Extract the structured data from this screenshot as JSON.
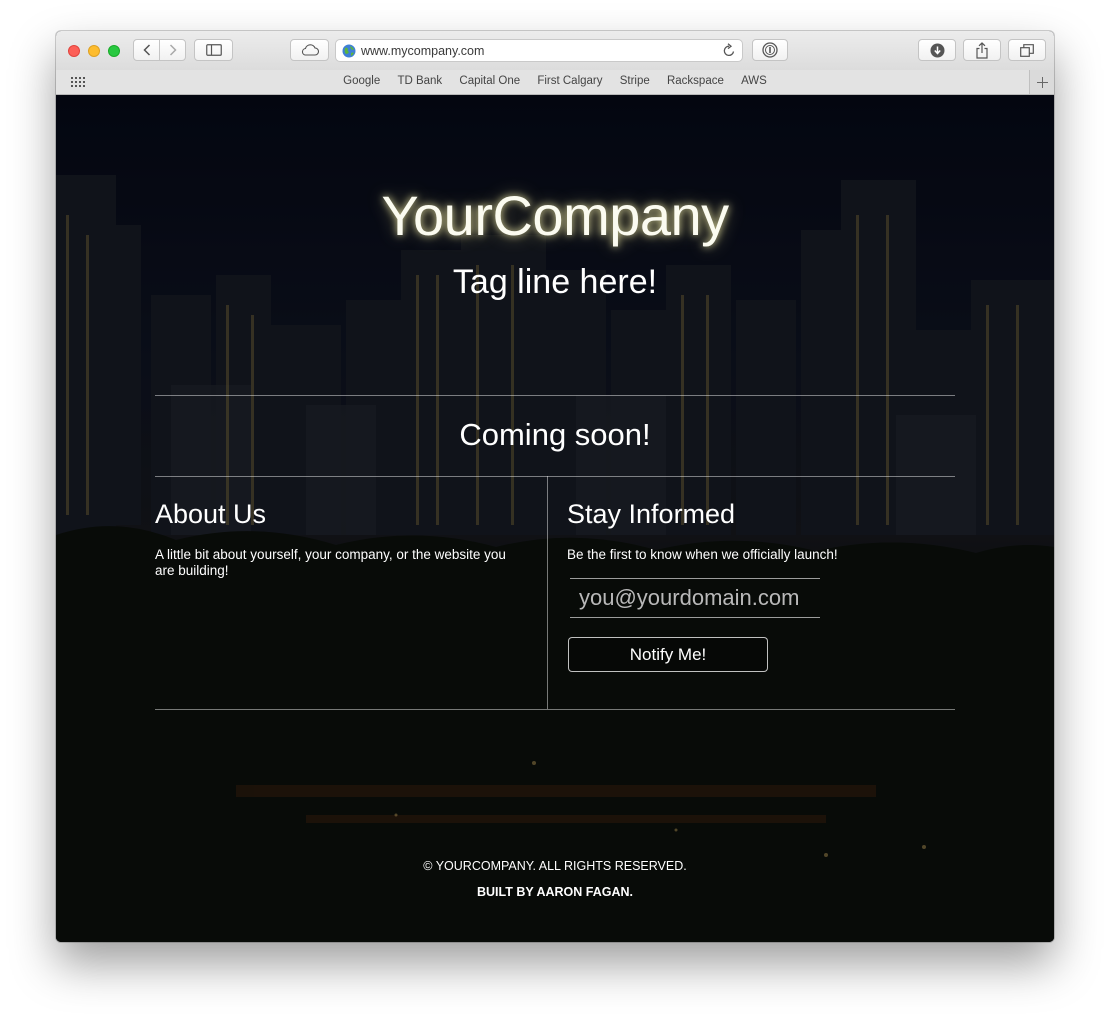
{
  "browser": {
    "url": "www.mycompany.com",
    "bookmarks": [
      "Google",
      "TD Bank",
      "Capital One",
      "First Calgary",
      "Stripe",
      "Rackspace",
      "AWS"
    ],
    "icons": {
      "back": "chevron-left-icon",
      "forward": "chevron-right-icon",
      "sidebar": "sidebar-icon",
      "cloud": "icloud-tabs-icon",
      "globe": "globe-icon",
      "reload": "reload-icon",
      "password": "1password-icon",
      "download": "download-icon",
      "share": "share-icon",
      "tabs": "tab-overview-icon",
      "grid": "grid-icon",
      "add": "plus-icon"
    }
  },
  "hero": {
    "brand": "YourCompany",
    "tagline": "Tag line here!"
  },
  "status": {
    "heading": "Coming soon!"
  },
  "about": {
    "title": "About Us",
    "text": "A little bit about yourself, your company, or the website you are building!"
  },
  "stay": {
    "title": "Stay Informed",
    "text": "Be the first to know when we officially launch!",
    "email_placeholder": "you@yourdomain.com",
    "email_value": "",
    "button_label": "Notify Me!"
  },
  "footer": {
    "copyright": "© YOURCOMPANY. ALL RIGHTS RESERVED.",
    "credit": "BUILT BY AARON FAGAN."
  },
  "colors": {
    "glow": "#fff5b0",
    "background": "#0b0f1c"
  }
}
